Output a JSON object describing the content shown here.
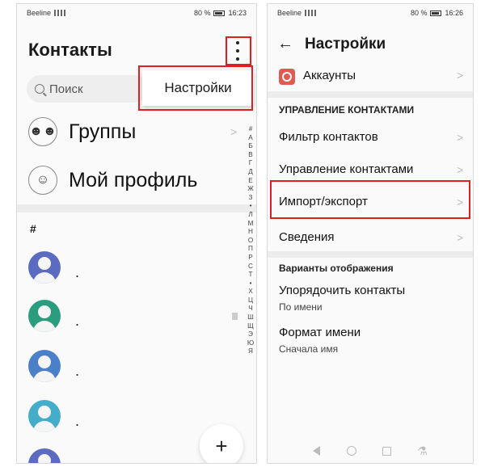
{
  "left_phone": {
    "status": {
      "carrier": "Beeline",
      "battery": "80 %",
      "time": "16:23"
    },
    "title": "Контакты",
    "search_placeholder": "Поиск",
    "menu_popup_item": "Настройки",
    "groups_label": "Группы",
    "profile_label": "Мой профиль",
    "section_letter": "#",
    "contacts": [
      {
        "name": "."
      },
      {
        "name": "."
      },
      {
        "name": "."
      },
      {
        "name": "."
      }
    ],
    "alphabet": [
      "#",
      "А",
      "Б",
      "В",
      "Г",
      "Д",
      "Е",
      "Ж",
      "З",
      "•",
      "Л",
      "М",
      "Н",
      "О",
      "П",
      "Р",
      "С",
      "Т",
      "•",
      "Х",
      "Ц",
      "Ч",
      "Ш",
      "Щ",
      "Э",
      "Ю",
      "Я"
    ],
    "fab_icon": "+",
    "chevron": ">"
  },
  "right_phone": {
    "status": {
      "carrier": "Beeline",
      "battery": "80 %",
      "time": "16:26"
    },
    "back_icon": "←",
    "title": "Настройки",
    "accounts_label": "Аккаунты",
    "section_manage": "УПРАВЛЕНИЕ КОНТАКТАМИ",
    "filter_label": "Фильтр контактов",
    "manage_label": "Управление контактами",
    "import_export_label": "Импорт/экспорт",
    "info_label": "Сведения",
    "section_display": "Варианты отображения",
    "sort_label": "Упорядочить контакты",
    "sort_value": "По имени",
    "name_format_label": "Формат имени",
    "name_format_value": "Сначала имя",
    "chevron": ">"
  },
  "colors": {
    "highlight": "#e02020",
    "accent_account": "#e05a52",
    "avatar_colors": [
      "#5b6bbf",
      "#2a9d7e",
      "#4a7fc9",
      "#44aeca"
    ]
  }
}
